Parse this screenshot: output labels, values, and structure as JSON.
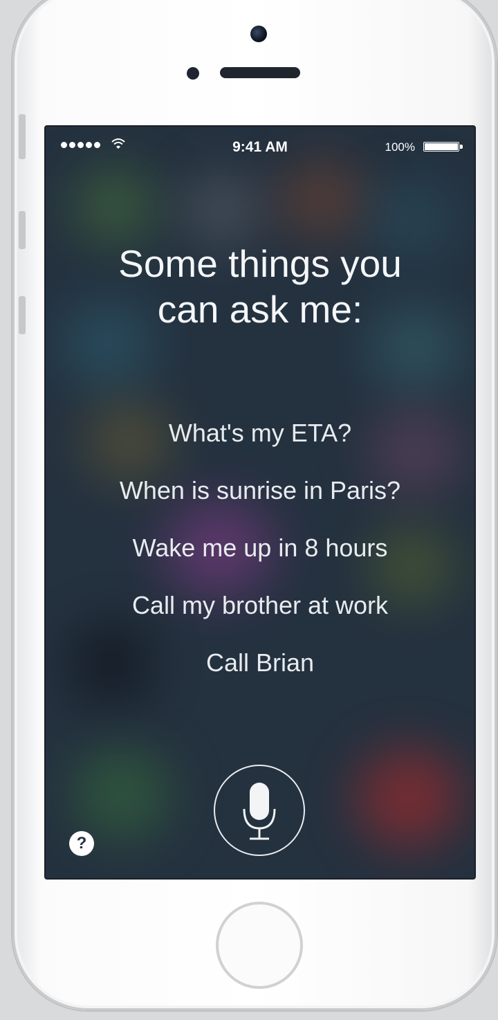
{
  "status_bar": {
    "time": "9:41 AM",
    "battery_percent": "100%",
    "signal_dots": 5,
    "icons": [
      "signal-icon",
      "wifi-icon",
      "battery-icon"
    ]
  },
  "siri": {
    "headline_line1": "Some things you",
    "headline_line2": "can ask me:",
    "suggestions": [
      "What's my ETA?",
      "When is sunrise in Paris?",
      "Wake me up in 8 hours",
      "Call my brother at work",
      "Call Brian"
    ],
    "help_label": "?",
    "mic_icon": "microphone-icon"
  },
  "device": {
    "home_button": "home-button-icon"
  },
  "colors": {
    "screen_background": "#24313f",
    "text": "#f4f6f8",
    "device_body": "#ffffff"
  }
}
